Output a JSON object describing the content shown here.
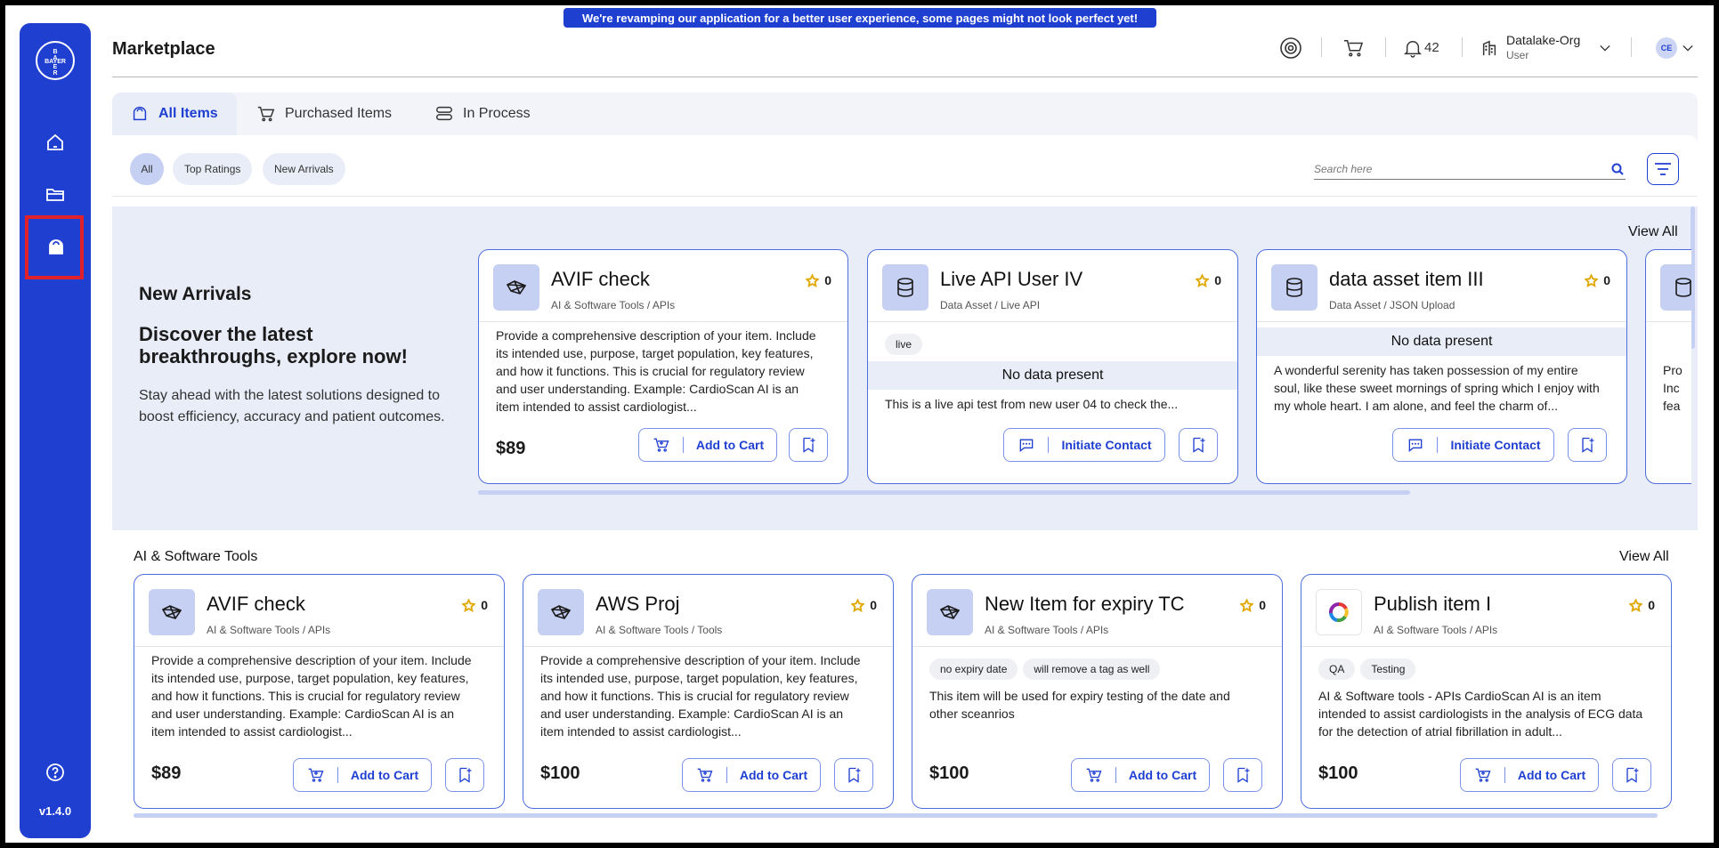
{
  "banner": {
    "text": "We're revamping our application for a better user experience, some pages might not look perfect yet!"
  },
  "sidebar": {
    "logo_text": "BAYER",
    "items": [
      {
        "name": "home",
        "icon": "home-icon"
      },
      {
        "name": "folder",
        "icon": "folder-icon"
      },
      {
        "name": "marketplace",
        "icon": "bag-icon",
        "active": true
      }
    ],
    "version": "v1.4.0"
  },
  "header": {
    "title": "Marketplace",
    "notification_count": "42",
    "org_name": "Datalake-Org",
    "org_role": "User",
    "avatar_initials": "CE"
  },
  "tabs": [
    {
      "label": "All Items",
      "active": true
    },
    {
      "label": "Purchased Items"
    },
    {
      "label": "In Process"
    }
  ],
  "filters": {
    "chips": [
      "All",
      "Top Ratings",
      "New Arrivals"
    ],
    "selected": "All",
    "search_placeholder": "Search here"
  },
  "new_arrivals": {
    "title": "New Arrivals",
    "subtitle": "Discover the latest breakthroughs, explore now!",
    "description": "Stay ahead with the latest solutions designed to boost efficiency, accuracy and patient outcomes.",
    "view_all": "View All",
    "cards": [
      {
        "title": "AVIF check",
        "category": "AI & Software Tools / APIs",
        "rating": "0",
        "description": "Provide a comprehensive description of your item. Include its intended use, purpose, target population, key features, and how it functions. This is crucial for regulatory review and user understanding. Example: CardioScan AI is an item intended to assist cardiologist...",
        "price": "$89",
        "action": "Add to Cart"
      },
      {
        "title": "Live API User IV",
        "category": "Data Asset / Live API",
        "rating": "0",
        "tags": [
          "live"
        ],
        "no_data": "No data present",
        "description": "This is a live api test from new user 04 to check the...",
        "action": "Initiate Contact"
      },
      {
        "title": "data asset item III",
        "category": "Data Asset / JSON Upload",
        "rating": "0",
        "no_data": "No data present",
        "description": "A wonderful serenity has taken possession of my entire soul, like these sweet mornings of spring which I enjoy with my whole heart. I am alone, and feel the charm of...",
        "action": "Initiate Contact"
      },
      {
        "partial_lines": [
          "Pro",
          "Inc",
          "fea"
        ]
      }
    ]
  },
  "ai_tools": {
    "title": "AI & Software Tools",
    "view_all": "View All",
    "cards": [
      {
        "title": "AVIF check",
        "category": "AI & Software Tools / APIs",
        "rating": "0",
        "description": "Provide a comprehensive description of your item. Include its intended use, purpose, target population, key features, and how it functions. This is crucial for regulatory review and user understanding. Example: CardioScan AI is an item intended to assist cardiologist...",
        "price": "$89",
        "action": "Add to Cart"
      },
      {
        "title": "AWS Proj",
        "category": "AI & Software Tools / Tools",
        "rating": "0",
        "description": "Provide a comprehensive description of your item. Include its intended use, purpose, target population, key features, and how it functions. This is crucial for regulatory review and user understanding. Example: CardioScan AI is an item intended to assist cardiologist...",
        "price": "$100",
        "action": "Add to Cart"
      },
      {
        "title": "New Item for expiry TC",
        "category": "AI & Software Tools / APIs",
        "rating": "0",
        "tags": [
          "no expiry date",
          "will remove a tag as well"
        ],
        "description": "This item will be used for expiry testing of the date and other sceanrios",
        "price": "$100",
        "action": "Add to Cart"
      },
      {
        "title": "Publish item I",
        "category": "AI & Software Tools / APIs",
        "rating": "0",
        "tags": [
          "QA",
          "Testing"
        ],
        "description": "AI & Software tools - APIs CardioScan AI is an item intended to assist cardiologists in the analysis of ECG data for the detection of atrial fibrillation in adult...",
        "price": "$100",
        "action": "Add to Cart"
      }
    ]
  },
  "colors": {
    "primary": "#1f3fd1",
    "highlight": "#e0202a",
    "star": "#e0a800",
    "section_bg": "#e9edf8"
  }
}
